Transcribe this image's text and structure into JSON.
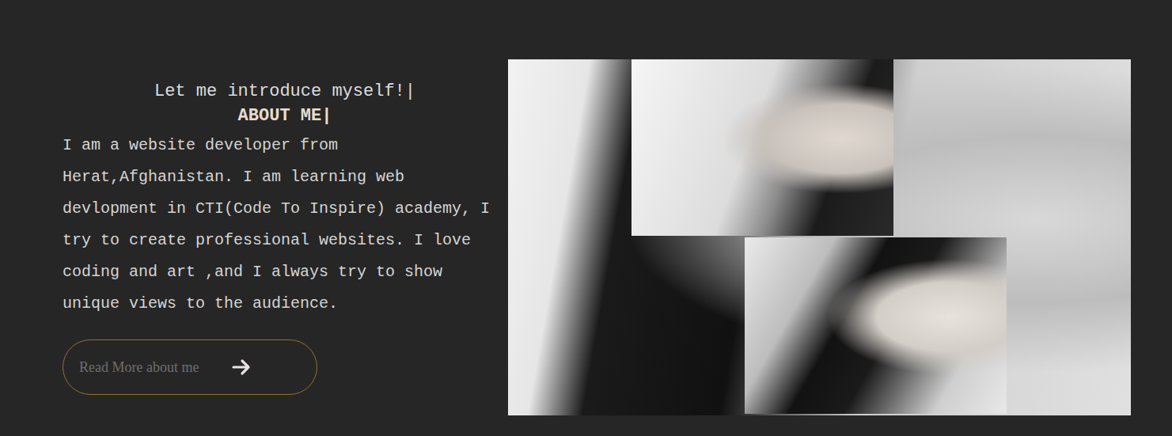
{
  "about": {
    "intro": "Let me introduce myself!|",
    "title": "ABOUT ME|",
    "paragraph": "I am a website developer from Herat,Afghanistan. I am learning web devlopment in CTI(Code To Inspire) academy, I try to create professional websites. I love coding and art ,and I always try to show unique views to the audience.",
    "button": {
      "label": "Read More about me"
    }
  }
}
